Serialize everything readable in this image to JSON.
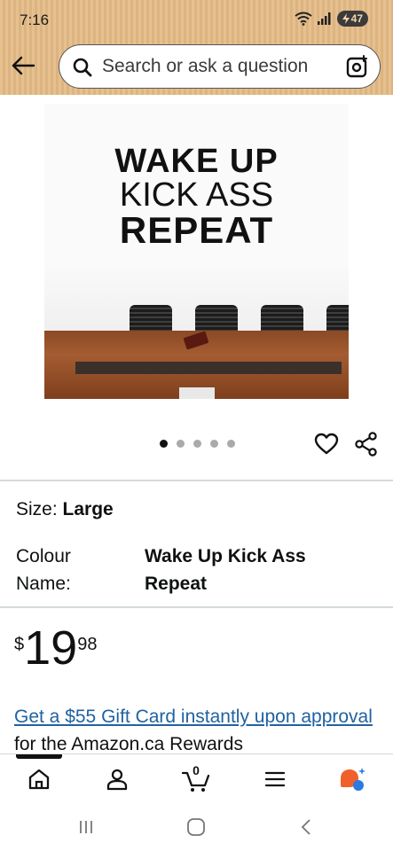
{
  "status_bar": {
    "time": "7:16",
    "battery": "47"
  },
  "header": {
    "search_placeholder": "Search or ask a question"
  },
  "product_image": {
    "wall_text": [
      "WAKE UP",
      "KICK ASS",
      "REPEAT"
    ],
    "carousel": {
      "total": 5,
      "active_index": 0
    }
  },
  "options": {
    "size_label": "Size:",
    "size_value": "Large",
    "colour_label": "Colour Name:",
    "colour_value": "Wake Up Kick Ass Repeat"
  },
  "price": {
    "currency_symbol": "$",
    "whole": "19",
    "fraction": "98"
  },
  "promo": {
    "link_text": "Get a $55 Gift Card instantly upon approval",
    "rest_text": " for the Amazon.ca Rewards"
  },
  "bottom_nav": {
    "items": [
      "home",
      "account",
      "cart",
      "menu",
      "rufus"
    ],
    "cart_count": "0"
  },
  "colors": {
    "header_bg": "#e6c08e",
    "link": "#2162a1",
    "rufus_orange": "#f0602d",
    "rufus_blue": "#2a7ae2"
  }
}
